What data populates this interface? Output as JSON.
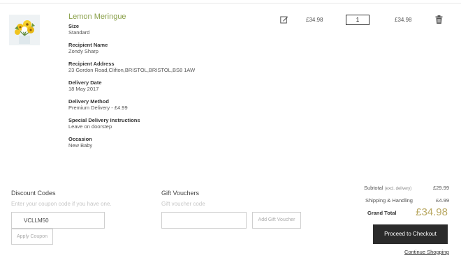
{
  "item": {
    "name": "Lemon Meringue",
    "image": "lemon-meringue-bouquet",
    "unit_price": "£34.98",
    "quantity": "1",
    "line_total": "£34.98",
    "details": [
      {
        "label": "Size",
        "value": "Standard"
      },
      {
        "label": "Recipient Name",
        "value": "Zondy Sharp"
      },
      {
        "label": "Recipient Address",
        "value": "23 Gordon Road,Clifton,BRISTOL,BRISTOL,BS8 1AW"
      },
      {
        "label": "Delivery Date",
        "value": "18 May 2017"
      },
      {
        "label": "Delivery Method",
        "value": "Premium Delivery - £4.99"
      },
      {
        "label": "Special Delivery Instructions",
        "value": "Leave on doorstep"
      },
      {
        "label": "Occasion",
        "value": "New Baby"
      }
    ]
  },
  "discount": {
    "title": "Discount Codes",
    "hint": "Enter your coupon code if you have one.",
    "value": "VCLLM50",
    "button": "Apply Coupon"
  },
  "voucher": {
    "title": "Gift Vouchers",
    "hint": "Gift voucher code",
    "value": "",
    "button": "Add Gift Voucher"
  },
  "totals": {
    "subtotal_label": "Subtotal",
    "subtotal_note": "(excl. delivery)",
    "subtotal_value": "£29.99",
    "shipping_label": "Shipping & Handling",
    "shipping_value": "£4.99",
    "grand_label": "Grand Total",
    "grand_value": "£34.98"
  },
  "actions": {
    "checkout": "Proceed to Checkout",
    "continue": "Continue Shopping"
  },
  "colors": {
    "accent_green": "#8aa04a",
    "accent_gold": "#b9a862",
    "button_dark": "#2b2b2b"
  },
  "icons": [
    "edit-icon",
    "trash-icon"
  ]
}
